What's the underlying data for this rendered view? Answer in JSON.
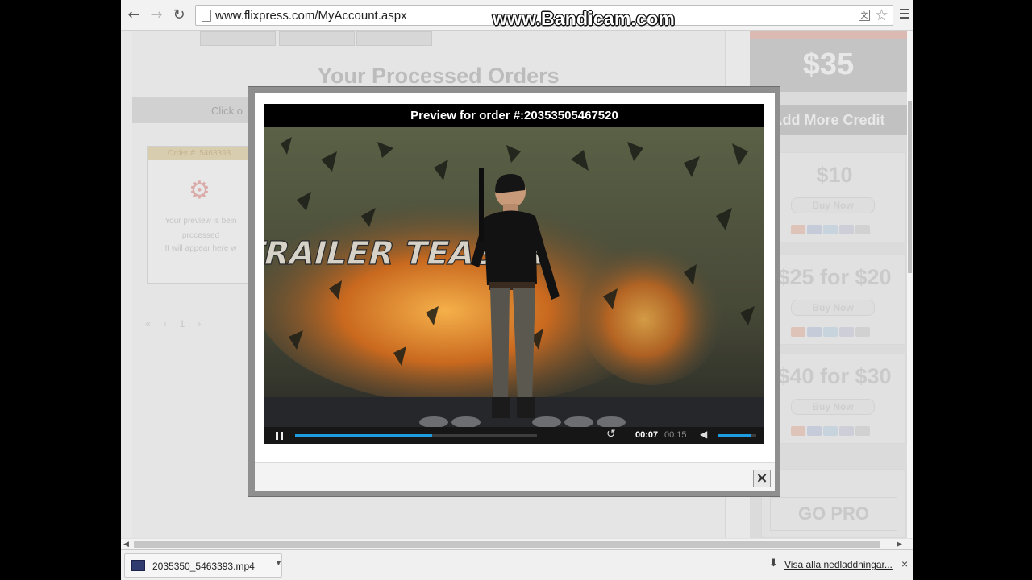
{
  "browser": {
    "url": "www.flixpress.com/MyAccount.aspx",
    "watermark": "www.Bandicam.com",
    "back_icon": "back-arrow-icon",
    "forward_icon": "forward-arrow-icon",
    "reload_icon": "reload-icon"
  },
  "page": {
    "title": "Your Processed Orders",
    "click_hint": "Click o",
    "order_card": {
      "header": "Order #: 5463393",
      "line1": "Your preview is bein",
      "line2": "processed",
      "line3": "It will appear here w"
    },
    "pager": "1"
  },
  "sidebar": {
    "price": "$35",
    "add_credit": "Add More Credit",
    "packages": [
      {
        "price": "$10",
        "buy": "Buy Now"
      },
      {
        "price": "$25 for $20",
        "buy": "Buy Now"
      },
      {
        "price": "$40 for $30",
        "buy": "Buy Now"
      }
    ],
    "go_pro": "GO PRO"
  },
  "modal": {
    "title": "Preview for order #:20353505467520",
    "player": {
      "time_current": "00:07",
      "time_separator": "|",
      "time_total": "00:15",
      "progress_fraction": 0.5667,
      "volume_fraction": 0.85,
      "video_title_text": "TRAILER TEASER"
    },
    "close_icon": "close-icon"
  },
  "downloads": {
    "file_name": "2035350_5463393.mp4",
    "show_all": "Visa alla nedladdningar...",
    "close": "×"
  },
  "colors": {
    "accent": "#1f9be0",
    "modal_border": "#8f8f8f",
    "watermark_outline": "#111111"
  }
}
